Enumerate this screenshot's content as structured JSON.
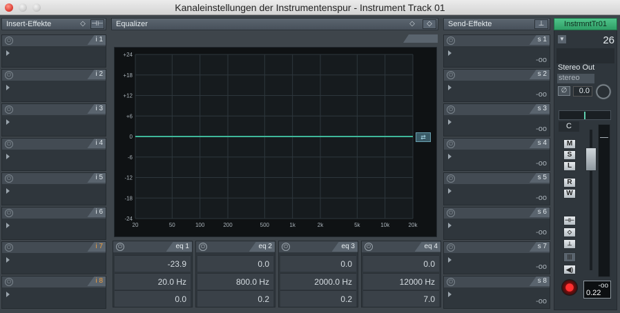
{
  "window": {
    "title": "Kanaleinstellungen der Instrumentenspur - Instrument Track 01"
  },
  "inserts": {
    "title": "Insert-Effekte",
    "slots": [
      {
        "label": "i 1",
        "active": false
      },
      {
        "label": "i 2",
        "active": false
      },
      {
        "label": "i 3",
        "active": false
      },
      {
        "label": "i 4",
        "active": false
      },
      {
        "label": "i 5",
        "active": false
      },
      {
        "label": "i 6",
        "active": false
      },
      {
        "label": "i 7",
        "active": true
      },
      {
        "label": "i 8",
        "active": true
      }
    ]
  },
  "equalizer": {
    "title": "Equalizer",
    "y_labels": [
      "+24",
      "+18",
      "+12",
      "+6",
      "0",
      "-6",
      "-12",
      "-18",
      "-24"
    ],
    "x_labels": [
      "20",
      "50",
      "100",
      "200",
      "500",
      "1k",
      "2k",
      "5k",
      "10k",
      "20k"
    ],
    "curve_color": "#3fb89a",
    "bands": [
      {
        "label": "eq 1",
        "gain": "-23.9",
        "freq": "20.0 Hz",
        "q": "0.0"
      },
      {
        "label": "eq 2",
        "gain": "0.0",
        "freq": "800.0 Hz",
        "q": "0.2"
      },
      {
        "label": "eq 3",
        "gain": "0.0",
        "freq": "2000.0 Hz",
        "q": "0.2"
      },
      {
        "label": "eq 4",
        "gain": "0.0",
        "freq": "12000 Hz",
        "q": "7.0"
      }
    ]
  },
  "sends": {
    "title": "Send-Effekte",
    "slots": [
      {
        "label": "s 1",
        "value": "-oo"
      },
      {
        "label": "s 2",
        "value": "-oo"
      },
      {
        "label": "s 3",
        "value": "-oo"
      },
      {
        "label": "s 4",
        "value": "-oo"
      },
      {
        "label": "s 5",
        "value": "-oo"
      },
      {
        "label": "s 6",
        "value": "-oo"
      },
      {
        "label": "s 7",
        "value": "-oo"
      },
      {
        "label": "s 8",
        "value": "-oo"
      }
    ]
  },
  "channel": {
    "name": "InstrmntTr01",
    "number": "26",
    "output": "Stereo Out",
    "output_type": "stereo",
    "phase_value": "0.0",
    "pan": "C",
    "buttons": {
      "mute": "M",
      "solo": "S",
      "listen": "L",
      "read": "R",
      "write": "W"
    },
    "meter_peak": "-oo",
    "volume": "0.22"
  }
}
